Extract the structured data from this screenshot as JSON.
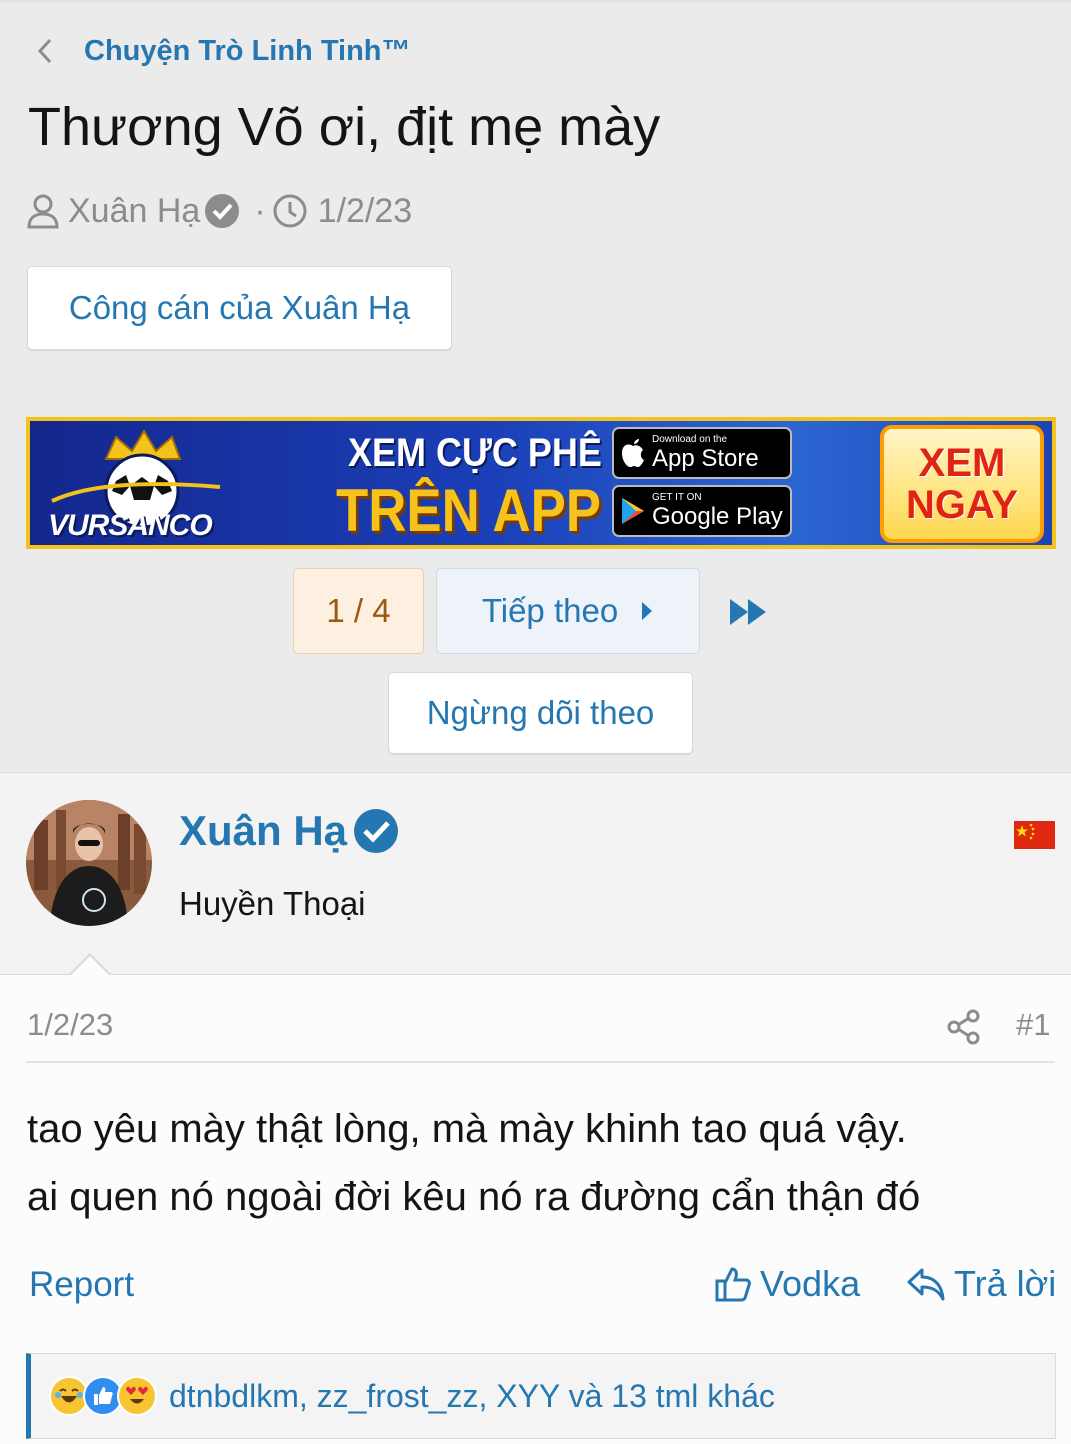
{
  "breadcrumb": {
    "label": "Chuyện Trò Linh Tinh™"
  },
  "thread": {
    "title": "Thương Võ ơi, địt mẹ mày",
    "author": "Xuân Hạ",
    "separator": "·",
    "date": "1/2/23"
  },
  "buttons": {
    "author_works": "Công cán của Xuân Hạ",
    "unwatch": "Ngừng dõi theo"
  },
  "banner": {
    "brand": "VURSANCO",
    "line1": "XEM CỰC PHÊ",
    "line2": "TRÊN APP",
    "app_store_small": "Download on the",
    "app_store_big": "App Store",
    "google_small": "GET IT ON",
    "google_big": "Google Play",
    "cta_line1": "XEM",
    "cta_line2": "NGAY"
  },
  "pagination": {
    "current": "1 / 4",
    "next_label": "Tiếp theo"
  },
  "post": {
    "username": "Xuân Hạ",
    "user_title": "Huyền Thoại",
    "date": "1/2/23",
    "number": "#1",
    "body_line1": "tao yêu mày thật lòng, mà mày khinh tao quá vậy.",
    "body_line2": "ai quen nó ngoài đời kêu nó ra đường cẩn thận đó",
    "report_label": "Report",
    "like_label": "Vodka",
    "reply_label": "Trả lời",
    "reactions_text": "dtnbdlkm, zz_frost_zz, XYY và 13 tml khác"
  },
  "icons": [
    "chevron-left-icon",
    "user-icon",
    "verified-icon",
    "clock-icon",
    "fast-forward-icon",
    "share-icon",
    "thumbs-up-icon",
    "reply-icon",
    "china-flag-icon",
    "laugh-emoji-icon",
    "like-emoji-icon",
    "love-emoji-icon"
  ],
  "colors": {
    "link": "#2577b1",
    "page_bg": "#ebebeb",
    "banner_gold": "#f3c21b",
    "cta_red": "#e02414"
  }
}
